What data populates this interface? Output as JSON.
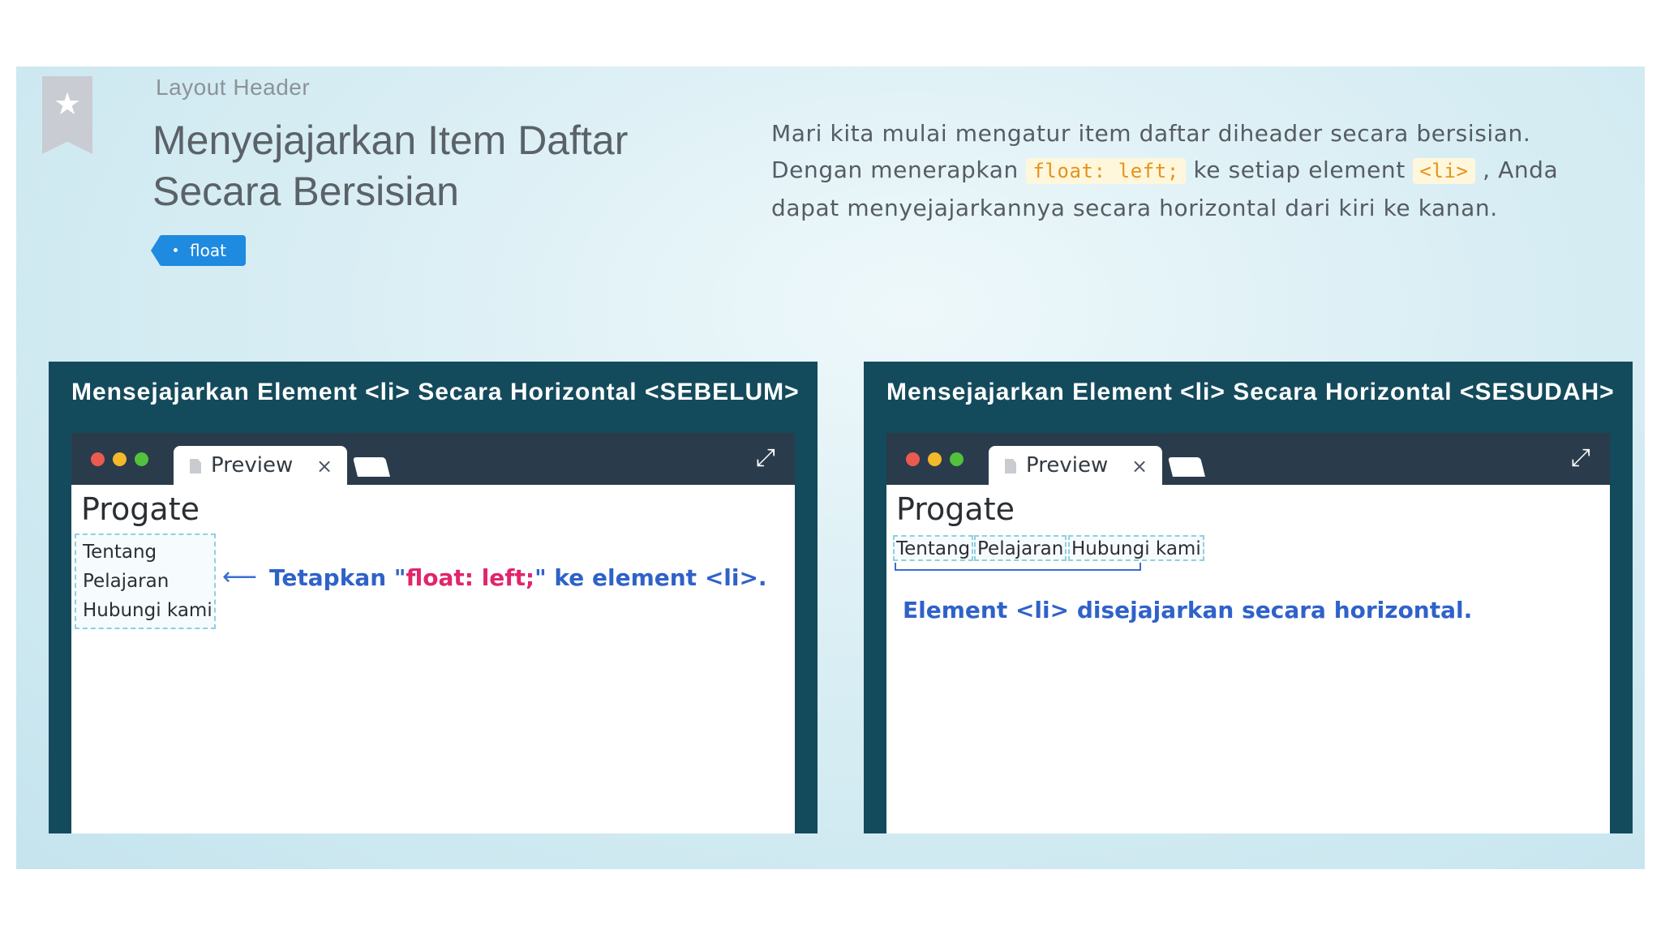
{
  "header": {
    "section_label": "Layout Header",
    "title_line1": "Menyejajarkan Item Daftar",
    "title_line2": "Secara Bersisian",
    "tag": "float"
  },
  "description": {
    "part1": "Mari kita mulai mengatur item daftar diheader secara bersisian. Dengan menerapkan ",
    "code1": "float: left;",
    "part2": " ke setiap element ",
    "code2": "<li>",
    "part3": " , Anda dapat menyejajarkannya secara horizontal dari kiri ke kanan."
  },
  "panels": [
    {
      "title": "Mensejajarkan Element <li> Secara Horizontal <SEBELUM>",
      "tab_label": "Preview",
      "tab_close": "×",
      "site_title": "Progate",
      "items": [
        "Tentang",
        "Pelajaran",
        "Hubungi kami"
      ],
      "annotation_prefix": "Tetapkan \"",
      "annotation_code": "float: left;",
      "annotation_suffix": "\" ke element <li>."
    },
    {
      "title": "Mensejajarkan Element <li> Secara Horizontal <SESUDAH>",
      "tab_label": "Preview",
      "tab_close": "×",
      "site_title": "Progate",
      "items": [
        "Tentang",
        "Pelajaran",
        "Hubungi kami"
      ],
      "note": "Element <li> disejajarkan secara horizontal."
    }
  ],
  "icons": {
    "bookmark": "star-bookmark-icon",
    "tab_doc": "document-icon",
    "expand": "expand-icon",
    "arrow": "left-arrow-icon"
  },
  "colors": {
    "panel_bg": "#144b5c",
    "browser_bar": "#2a3b4c",
    "tag_blue": "#1e8ae0",
    "annotation_blue": "#2f62c9",
    "annotation_pink": "#e2246b",
    "code_orange": "#e5931a"
  }
}
